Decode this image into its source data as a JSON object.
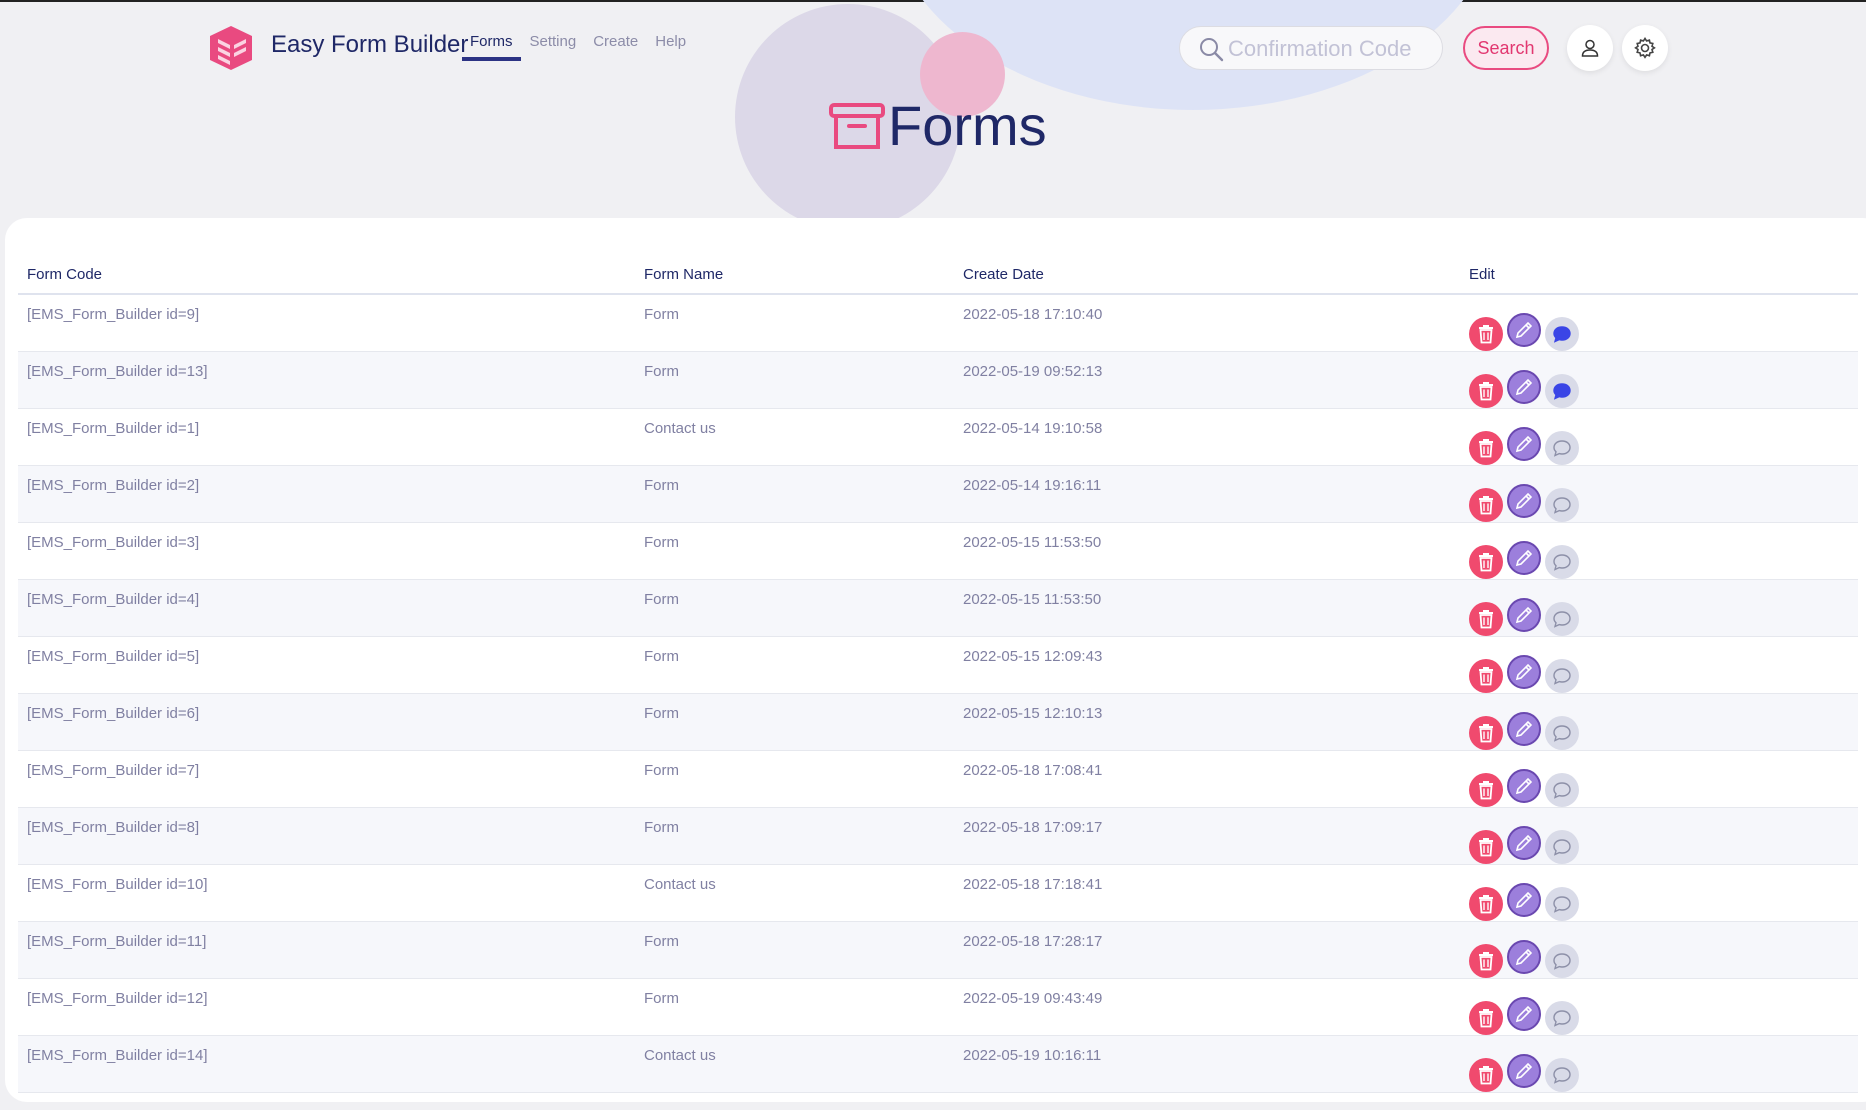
{
  "header": {
    "brand": "Easy Form Builder",
    "nav": [
      {
        "label": "Forms",
        "active": true
      },
      {
        "label": "Setting",
        "active": false
      },
      {
        "label": "Create",
        "active": false
      },
      {
        "label": "Help",
        "active": false
      }
    ],
    "search": {
      "placeholder": "Confirmation Code",
      "button_label": "Search"
    },
    "icons": [
      "user-icon",
      "gear-icon"
    ]
  },
  "page": {
    "title": "Forms",
    "title_icon": "archive-box-icon"
  },
  "colors": {
    "accent_pink": "#e94a80",
    "navy": "#1f2867",
    "delete_red": "#f04a6e",
    "edit_purple": "#9c7fdc",
    "new_message_blue": "#3a45e6"
  },
  "table": {
    "columns": [
      "Form Code",
      "Form Name",
      "Create Date",
      "Edit"
    ],
    "rows": [
      {
        "code": "[EMS_Form_Builder id=9]",
        "name": "Form",
        "date": "2022-05-18 17:10:40",
        "has_new_messages": true
      },
      {
        "code": "[EMS_Form_Builder id=13]",
        "name": "Form",
        "date": "2022-05-19 09:52:13",
        "has_new_messages": true
      },
      {
        "code": "[EMS_Form_Builder id=1]",
        "name": "Contact us",
        "date": "2022-05-14 19:10:58",
        "has_new_messages": false
      },
      {
        "code": "[EMS_Form_Builder id=2]",
        "name": "Form",
        "date": "2022-05-14 19:16:11",
        "has_new_messages": false
      },
      {
        "code": "[EMS_Form_Builder id=3]",
        "name": "Form",
        "date": "2022-05-15 11:53:50",
        "has_new_messages": false
      },
      {
        "code": "[EMS_Form_Builder id=4]",
        "name": "Form",
        "date": "2022-05-15 11:53:50",
        "has_new_messages": false
      },
      {
        "code": "[EMS_Form_Builder id=5]",
        "name": "Form",
        "date": "2022-05-15 12:09:43",
        "has_new_messages": false
      },
      {
        "code": "[EMS_Form_Builder id=6]",
        "name": "Form",
        "date": "2022-05-15 12:10:13",
        "has_new_messages": false
      },
      {
        "code": "[EMS_Form_Builder id=7]",
        "name": "Form",
        "date": "2022-05-18 17:08:41",
        "has_new_messages": false
      },
      {
        "code": "[EMS_Form_Builder id=8]",
        "name": "Form",
        "date": "2022-05-18 17:09:17",
        "has_new_messages": false
      },
      {
        "code": "[EMS_Form_Builder id=10]",
        "name": "Contact us",
        "date": "2022-05-18 17:18:41",
        "has_new_messages": false
      },
      {
        "code": "[EMS_Form_Builder id=11]",
        "name": "Form",
        "date": "2022-05-18 17:28:17",
        "has_new_messages": false
      },
      {
        "code": "[EMS_Form_Builder id=12]",
        "name": "Form",
        "date": "2022-05-19 09:43:49",
        "has_new_messages": false
      },
      {
        "code": "[EMS_Form_Builder id=14]",
        "name": "Contact us",
        "date": "2022-05-19 10:16:11",
        "has_new_messages": false
      }
    ]
  }
}
